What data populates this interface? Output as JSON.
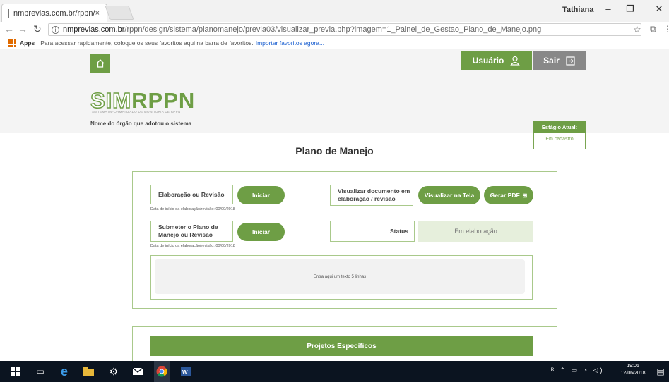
{
  "browser": {
    "tab_title": "nmprevias.com.br/rppn/",
    "tab_close": "×",
    "window_user": "Tathiana",
    "url_host": "nmprevias.com.br",
    "url_path": "/rppn/design/sistema/planomanejo/previa03/visualizar_previa.php?imagem=1_Painel_de_Gestao_Plano_de_Manejo.png",
    "bookmarks_apps": "Apps",
    "bookmarks_hint": "Para acessar rapidamente, coloque os seus favoritos aqui na barra de favoritos.",
    "bookmarks_link": "Importar favoritos agora..."
  },
  "header": {
    "user_button": "Usuário",
    "logout_button": "Sair",
    "logo_sim": "SIM",
    "logo_rppn": "RPPN",
    "logo_subtitle": "SISTEMA INFORMATIZADO DE MONITORIA DE RPPN",
    "org_name": "Nome do órgão que adotou o sistema",
    "stage_label": "Estágio Atual:",
    "stage_value": "Em cadastro"
  },
  "page": {
    "title": "Plano de Manejo"
  },
  "panel": {
    "elaboracao_label": "Elaboração ou Revisão",
    "iniciar_1": "Iniciar",
    "date_1": "Data de início da elaboração/revisão: 00/00/2018",
    "visualizar_label": "Visualizar documento em elaboração / revisão",
    "visualizar_tela_button": "Visualizar na Tela",
    "gerar_pdf_button": "Gerar PDF",
    "submeter_label": "Submeter o Plano de Manejo ou Revisão",
    "iniciar_2": "Iniciar",
    "date_2": "Data de início da elaboração/revisão: 00/00/2018",
    "status_label": "Status",
    "status_value": "Em elaboração",
    "text_placeholder": "Entra aqui um texto 5 linhas"
  },
  "projetos": {
    "title": "Projetos Específicos"
  },
  "taskbar": {
    "time": "19:06",
    "date": "12/06/2018"
  }
}
